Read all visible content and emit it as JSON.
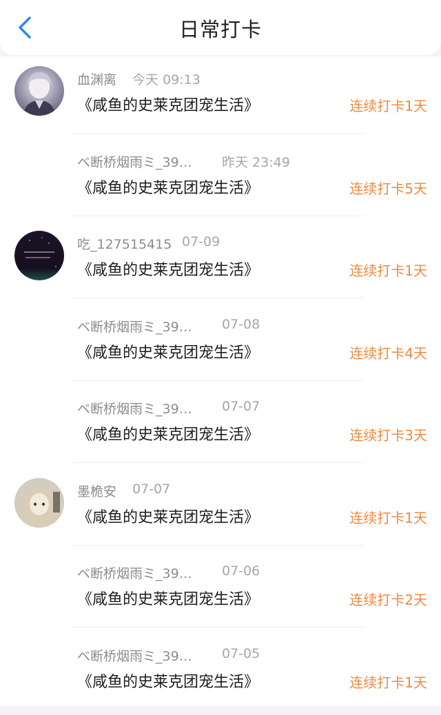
{
  "header": {
    "title": "日常打卡",
    "back_icon": "chevron-left-icon",
    "accent": "#2b8ce8"
  },
  "colors": {
    "streak": "#ef8a3f",
    "name": "#8c8c8c"
  },
  "items": [
    {
      "user": "血渊离",
      "time": "今天 09:13",
      "book": "《咸鱼的史莱克团宠生活》",
      "streak": "连续打卡1天",
      "avatar": "avatar-anime-boy"
    },
    {
      "user": "ベ断桥烟雨ミ_39…",
      "time": "昨天 23:49",
      "book": "《咸鱼的史莱克团宠生活》",
      "streak": "连续打卡5天",
      "avatar": ""
    },
    {
      "user": "吃_127515415",
      "time": "07-09",
      "book": "《咸鱼的史莱克团宠生活》",
      "streak": "连续打卡1天",
      "avatar": "avatar-night-sky"
    },
    {
      "user": "ベ断桥烟雨ミ_39…",
      "time": "07-08",
      "book": "《咸鱼的史莱克团宠生活》",
      "streak": "连续打卡4天",
      "avatar": ""
    },
    {
      "user": "ベ断桥烟雨ミ_39…",
      "time": "07-07",
      "book": "《咸鱼的史莱克团宠生活》",
      "streak": "连续打卡3天",
      "avatar": ""
    },
    {
      "user": "墨桅安",
      "time": "07-07",
      "book": "《咸鱼的史莱克团宠生活》",
      "streak": "连续打卡1天",
      "avatar": "avatar-anime-girl"
    },
    {
      "user": "ベ断桥烟雨ミ_39…",
      "time": "07-06",
      "book": "《咸鱼的史莱克团宠生活》",
      "streak": "连续打卡2天",
      "avatar": ""
    },
    {
      "user": "ベ断桥烟雨ミ_39…",
      "time": "07-05",
      "book": "《咸鱼的史莱克团宠生活》",
      "streak": "连续打卡1天",
      "avatar": ""
    }
  ]
}
